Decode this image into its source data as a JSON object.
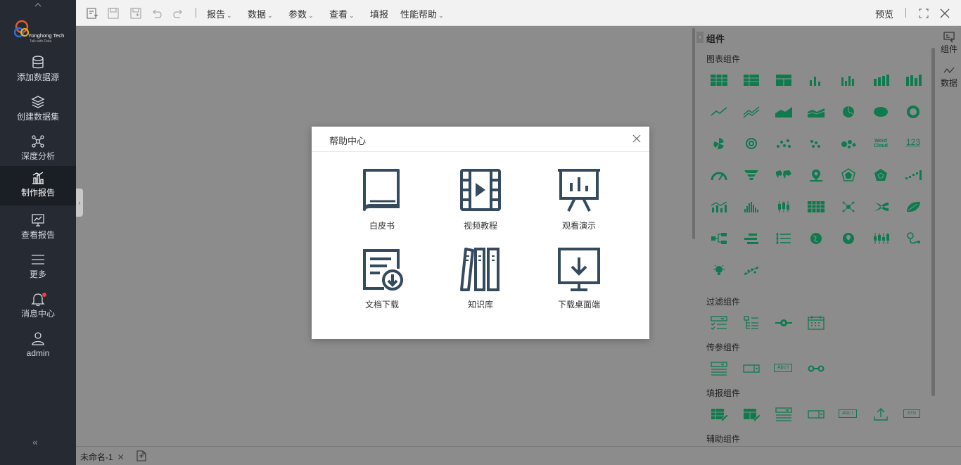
{
  "logo": {
    "brand": "Yonghong Tech",
    "tagline": "Talk with Data"
  },
  "nav": [
    {
      "label": "添加数据源",
      "icon": "database-icon"
    },
    {
      "label": "创建数据集",
      "icon": "layers-icon"
    },
    {
      "label": "深度分析",
      "icon": "network-icon"
    },
    {
      "label": "制作报告",
      "icon": "report-chart-icon",
      "active": true
    },
    {
      "label": "查看报告",
      "icon": "monitor-chart-icon"
    },
    {
      "label": "更多",
      "icon": "menu-icon"
    },
    {
      "label": "消息中心",
      "icon": "bell-icon"
    },
    {
      "label": "admin",
      "icon": "user-icon"
    }
  ],
  "toolbar": {
    "menus": [
      "报告",
      "数据",
      "参数",
      "查看",
      "填报",
      "性能帮助"
    ],
    "preview": "预览"
  },
  "right_panel": {
    "title": "组件",
    "sections": [
      "图表组件",
      "过滤组件",
      "传参组件",
      "填报组件",
      "辅助组件"
    ],
    "wordcloud_text": "Word Cloud",
    "number_text": "123",
    "abc_text": "Abc I",
    "btn_text": "BTN"
  },
  "right_tabs": [
    "组件",
    "数据"
  ],
  "bottom": {
    "doc_tab": "未命名-1"
  },
  "dialog": {
    "title": "帮助中心",
    "items": [
      "白皮书",
      "视频教程",
      "观看演示",
      "文档下载",
      "知识库",
      "下载桌面端"
    ]
  },
  "colors": {
    "accent_green": "#0e7a4e",
    "nav_bg": "#252a33",
    "dialog_icon": "#344a5e"
  }
}
